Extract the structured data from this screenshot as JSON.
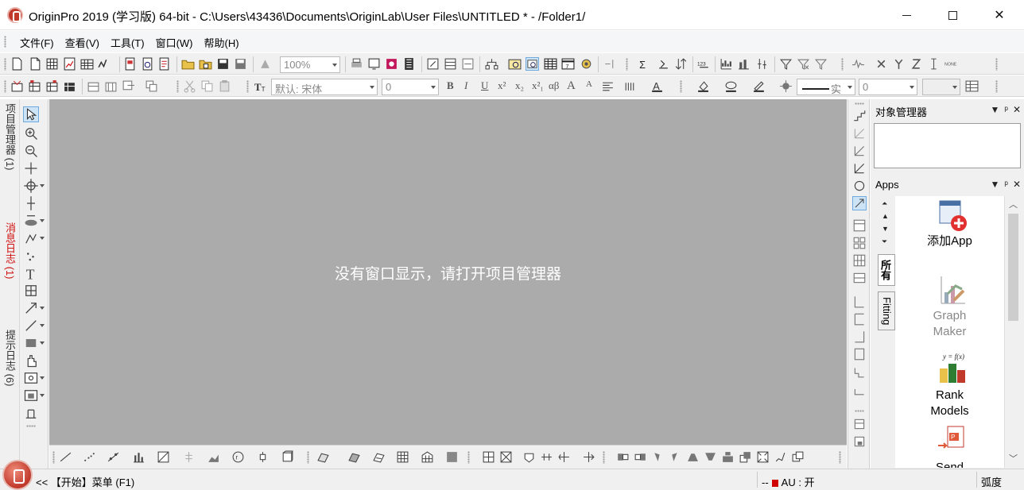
{
  "window": {
    "title": "OriginPro 2019 (学习版) 64-bit - C:\\Users\\43436\\Documents\\OriginLab\\User Files\\UNTITLED * - /Folder1/",
    "close_glyph": "✕"
  },
  "menu": [
    "文件(F)",
    "查看(V)",
    "工具(T)",
    "窗口(W)",
    "帮助(H)"
  ],
  "toolbar1": {
    "zoom_value": "100%"
  },
  "toolbar2": {
    "font_value": "默认: 宋体",
    "font_size_value": "0",
    "line_width_value": "0",
    "format_labels": [
      "B",
      "I",
      "U",
      "x²",
      "x₂",
      "x²₁",
      "αβ",
      "A",
      "A"
    ],
    "line_style_label": "实"
  },
  "left_dock": {
    "tabs": [
      "项目管理器 (1)",
      "消息日志 (1)",
      "提示日志 (6)"
    ]
  },
  "workspace": {
    "message": "没有窗口显示，请打开项目管理器",
    "background": "#ababab"
  },
  "object_manager": {
    "title": "对象管理器"
  },
  "apps_panel": {
    "title": "Apps",
    "tabs": [
      "所有",
      "Fitting"
    ],
    "items": [
      {
        "label_line1": "添加App",
        "label_line2": "",
        "icon": "add-app-icon",
        "dimmed": false
      },
      {
        "label_line1": "Graph",
        "label_line2": "Maker",
        "icon": "graph-maker-icon",
        "dimmed": true
      },
      {
        "label_line1": "Rank",
        "label_line2": "Models",
        "icon": "rank-models-icon",
        "dimmed": false
      },
      {
        "label_line1": "Send",
        "label_line2": "",
        "icon": "send-icon",
        "dimmed": false
      }
    ]
  },
  "statusbar": {
    "start_hint": "<< 【开始】菜单 (F1)",
    "dashes": "--",
    "au_status": "AU : 开",
    "angle_unit": "弧度"
  },
  "colors": {
    "accent_red": "#c0392b",
    "selected_tool": "#cde4f7"
  }
}
